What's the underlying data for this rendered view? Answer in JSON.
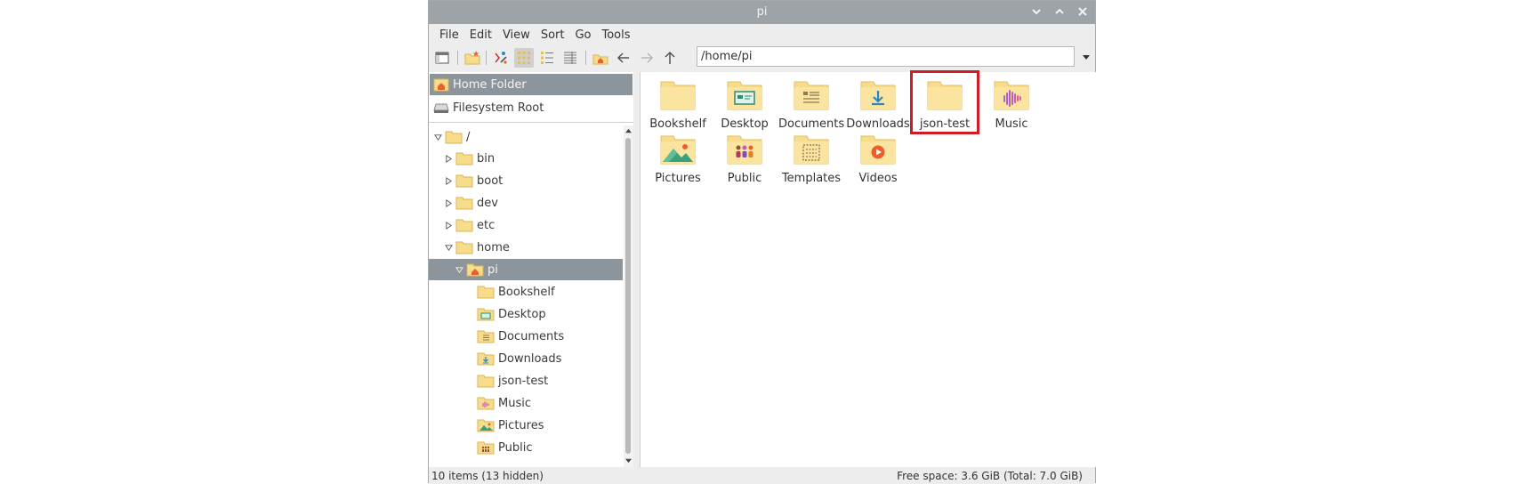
{
  "window": {
    "title": "pi"
  },
  "menu": [
    "File",
    "Edit",
    "View",
    "Sort",
    "Go",
    "Tools"
  ],
  "path": {
    "value": "/home/pi"
  },
  "places": [
    {
      "label": "Home Folder",
      "icon": "home-icon",
      "selected": true
    },
    {
      "label": "Filesystem Root",
      "icon": "drive-icon",
      "selected": false
    }
  ],
  "tree": [
    {
      "label": "/",
      "depth": 0,
      "expanded": true
    },
    {
      "label": "bin",
      "depth": 1
    },
    {
      "label": "boot",
      "depth": 1
    },
    {
      "label": "dev",
      "depth": 1
    },
    {
      "label": "etc",
      "depth": 1
    },
    {
      "label": "home",
      "depth": 1,
      "expanded": true
    },
    {
      "label": "pi",
      "depth": 2,
      "expanded": true,
      "selected": true,
      "icon": "home"
    },
    {
      "label": "Bookshelf",
      "depth": 3
    },
    {
      "label": "Desktop",
      "depth": 3,
      "icon": "desktop"
    },
    {
      "label": "Documents",
      "depth": 3,
      "icon": "documents"
    },
    {
      "label": "Downloads",
      "depth": 3,
      "icon": "downloads"
    },
    {
      "label": "json-test",
      "depth": 3
    },
    {
      "label": "Music",
      "depth": 3,
      "icon": "music"
    },
    {
      "label": "Pictures",
      "depth": 3,
      "icon": "pictures"
    },
    {
      "label": "Public",
      "depth": 3,
      "icon": "public"
    }
  ],
  "files": [
    {
      "label": "Bookshelf",
      "icon": "folder"
    },
    {
      "label": "Desktop",
      "icon": "desktop"
    },
    {
      "label": "Documents",
      "icon": "documents"
    },
    {
      "label": "Downloads",
      "icon": "downloads"
    },
    {
      "label": "json-test",
      "icon": "folder",
      "highlighted": true
    },
    {
      "label": "Music",
      "icon": "music"
    },
    {
      "label": "Pictures",
      "icon": "pictures"
    },
    {
      "label": "Public",
      "icon": "public"
    },
    {
      "label": "Templates",
      "icon": "templates"
    },
    {
      "label": "Videos",
      "icon": "videos"
    }
  ],
  "status": {
    "items": "10 items (13 hidden)",
    "space": "Free space: 3.6 GiB (Total: 7.0 GiB)"
  },
  "colors": {
    "folder": "#f7dc8c",
    "folder_edge": "#e2bf5e",
    "selection": "#8d959c",
    "highlight": "#d01c24",
    "home": "#e8602c"
  }
}
